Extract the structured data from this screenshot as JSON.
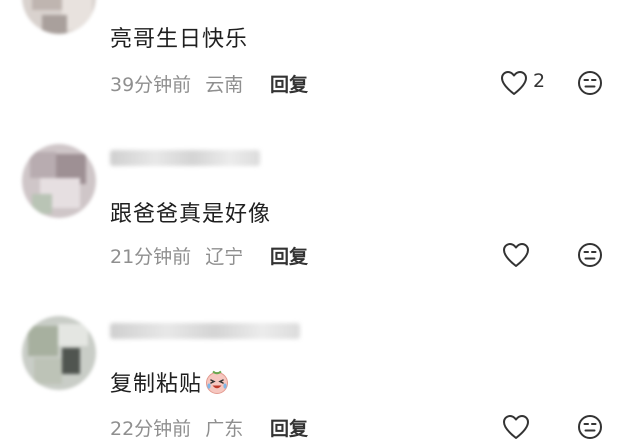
{
  "comments": [
    {
      "text": "亮哥生日快乐",
      "time": "39分钟前",
      "location": "云南",
      "reply_label": "回复",
      "likes": "2"
    },
    {
      "text": "跟爸爸真是好像",
      "time": "21分钟前",
      "location": "辽宁",
      "reply_label": "回复",
      "likes": ""
    },
    {
      "text": "复制粘贴",
      "time": "22分钟前",
      "location": "广东",
      "reply_label": "回复",
      "likes": "",
      "emoji": "crying-laughing-face-emoji"
    }
  ],
  "icons": {
    "like": "heart-outline-icon",
    "dislike": "unamused-face-icon"
  },
  "colors": {
    "text": "#1f1f1f",
    "meta": "#8f8f8f",
    "icon": "#333333"
  }
}
